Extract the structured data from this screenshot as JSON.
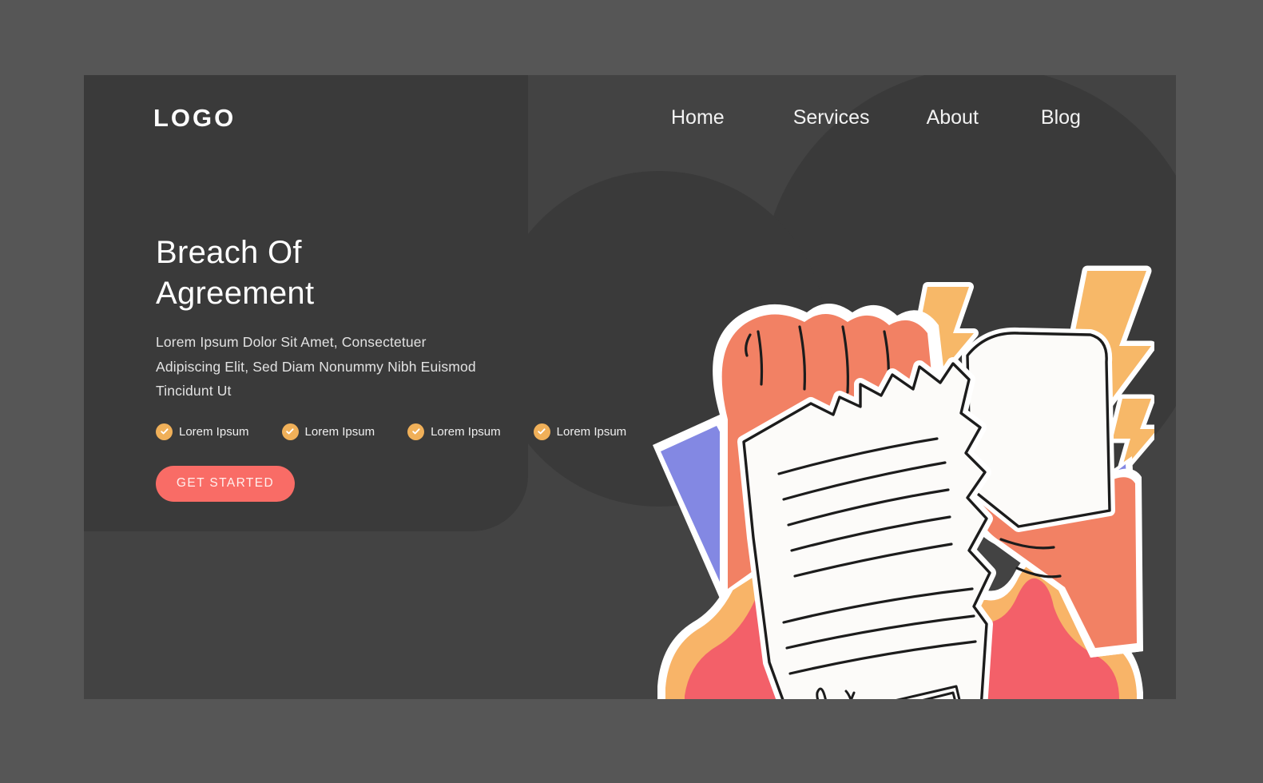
{
  "page": {
    "background_color": "#565656",
    "panel_color": "#434343",
    "content_slab_color": "#3A3A3A"
  },
  "header": {
    "logo": "LOGO",
    "nav": [
      {
        "label": "Home"
      },
      {
        "label": "Services"
      },
      {
        "label": "About"
      },
      {
        "label": "Blog"
      }
    ]
  },
  "hero": {
    "title_line1": "Breach Of",
    "title_line2": "Agreement",
    "subtitle": "Lorem Ipsum Dolor Sit Amet, Consectetuer Adipiscing Elit, Sed Diam Nonummy Nibh Euismod Tincidunt Ut",
    "features": [
      {
        "label": "Lorem Ipsum",
        "icon": "check-circle-icon"
      },
      {
        "label": "Lorem Ipsum",
        "icon": "check-circle-icon"
      },
      {
        "label": "Lorem Ipsum",
        "icon": "check-circle-icon"
      },
      {
        "label": "Lorem Ipsum",
        "icon": "check-circle-icon"
      }
    ],
    "cta_label": "GET STARTED"
  },
  "colors": {
    "accent_coral": "#F96C66",
    "check_amber": "#F0B059",
    "skin": "#F28164",
    "sleeve_purple": "#8388E3",
    "flame_red": "#F36069",
    "flame_orange": "#F8B468",
    "bolt_amber": "#F7B868",
    "paper_white": "#FCFBF9",
    "ink": "#1C1C1C"
  },
  "illustration": {
    "name": "hands-tearing-contract-illustration",
    "elements": [
      "left-hand-gripping-torn-document",
      "right-hand-gripping-torn-document",
      "torn-contract-document",
      "contract-signature",
      "contract-stamp-box",
      "lightning-bolt-small",
      "lightning-bolt-large",
      "lightning-bolt-tiny",
      "flame-base",
      "purple-shirt-cuff-left",
      "purple-shirt-cuff-right"
    ]
  }
}
